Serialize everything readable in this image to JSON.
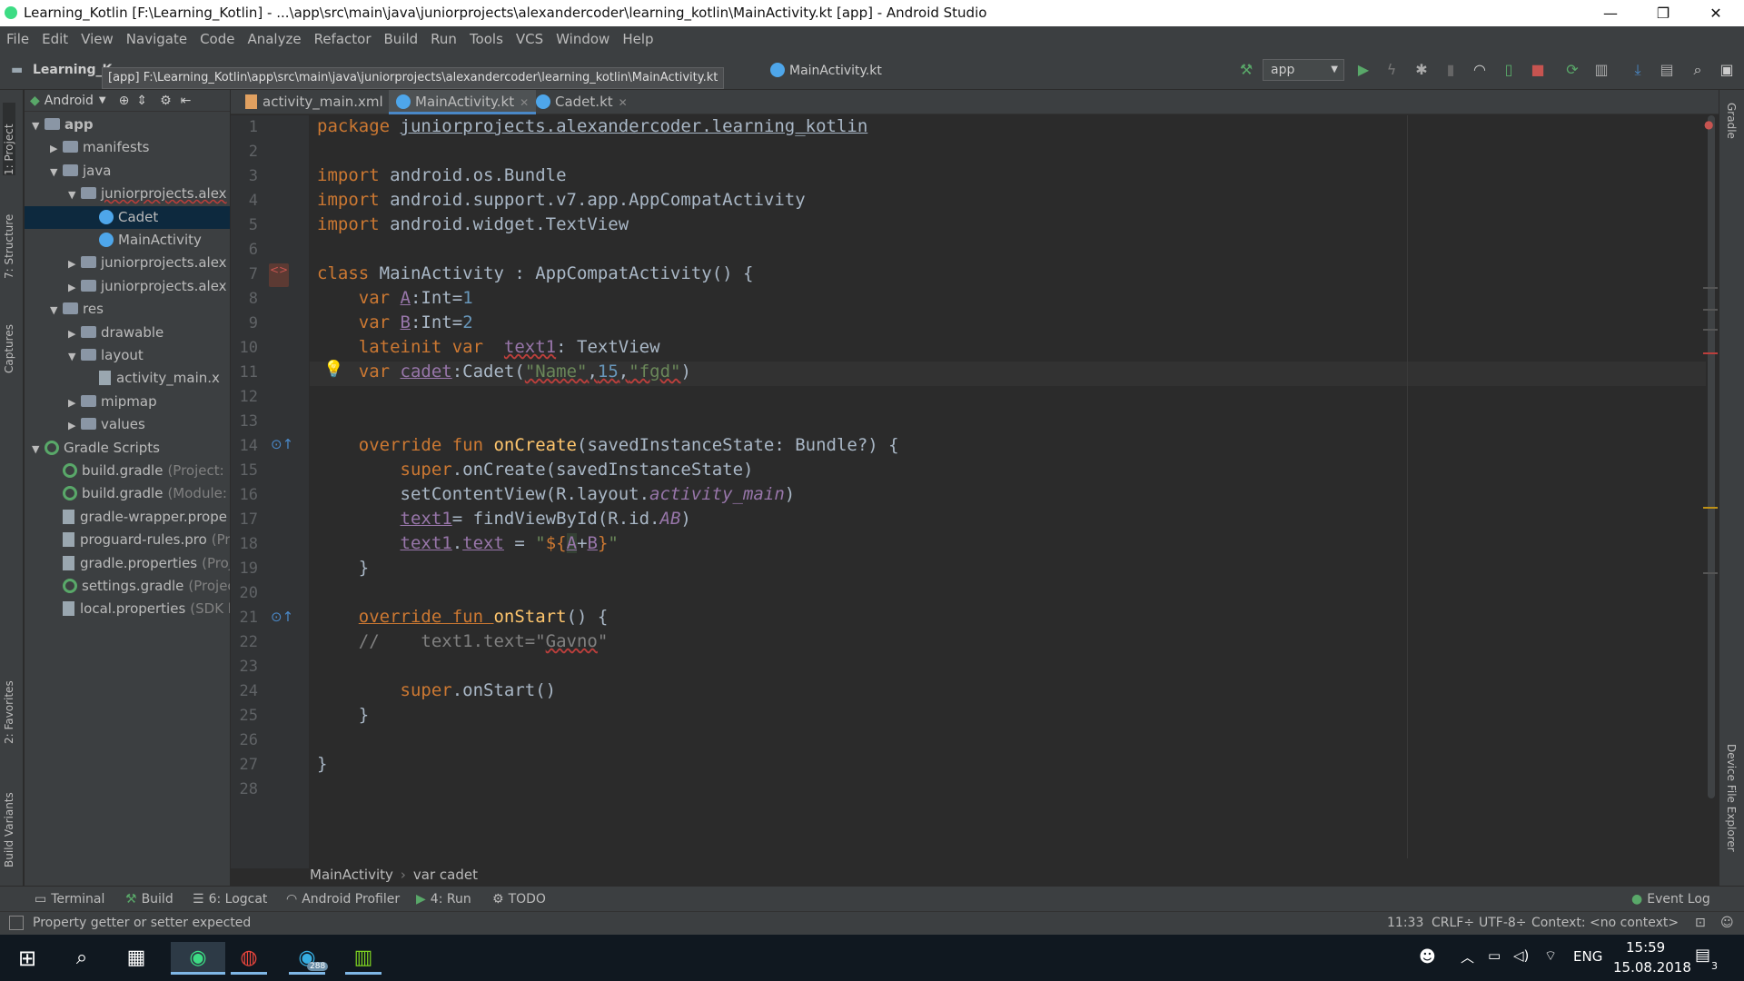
{
  "window": {
    "title": "Learning_Kotlin [F:\\Learning_Kotlin] - ...\\app\\src\\main\\java\\juniorprojects\\alexandercoder\\learning_kotlin\\MainActivity.kt [app] - Android Studio",
    "minimize": "—",
    "maximize": "❐",
    "close": "✕"
  },
  "menu": [
    "File",
    "Edit",
    "View",
    "Navigate",
    "Code",
    "Analyze",
    "Refactor",
    "Build",
    "Run",
    "Tools",
    "VCS",
    "Window",
    "Help"
  ],
  "toolbar": {
    "project_crumb": "Learning_K",
    "path_tooltip": "[app] F:\\Learning_Kotlin\\app\\src\\main\\java\\juniorprojects\\alexandercoder\\learning_kotlin\\MainActivity.kt",
    "file_crumb": "MainActivity.kt",
    "run_config": "app"
  },
  "project_panel": {
    "view_mode": "Android",
    "tree": [
      {
        "label": "app",
        "level": 0,
        "expanded": true,
        "type": "module"
      },
      {
        "label": "manifests",
        "level": 1,
        "expanded": false,
        "type": "folder"
      },
      {
        "label": "java",
        "level": 1,
        "expanded": true,
        "type": "folder"
      },
      {
        "label": "juniorprojects.alex",
        "level": 2,
        "expanded": true,
        "type": "package"
      },
      {
        "label": "Cadet",
        "level": 3,
        "type": "kotlin",
        "selected": true
      },
      {
        "label": "MainActivity",
        "level": 3,
        "type": "kotlin"
      },
      {
        "label": "juniorprojects.alex",
        "level": 2,
        "expanded": false,
        "type": "package"
      },
      {
        "label": "juniorprojects.alex",
        "level": 2,
        "expanded": false,
        "type": "package"
      },
      {
        "label": "res",
        "level": 1,
        "expanded": true,
        "type": "folder"
      },
      {
        "label": "drawable",
        "level": 2,
        "expanded": false,
        "type": "folder"
      },
      {
        "label": "layout",
        "level": 2,
        "expanded": true,
        "type": "folder"
      },
      {
        "label": "activity_main.x",
        "level": 3,
        "type": "file"
      },
      {
        "label": "mipmap",
        "level": 2,
        "expanded": false,
        "type": "folder"
      },
      {
        "label": "values",
        "level": 2,
        "expanded": false,
        "type": "folder"
      },
      {
        "label": "Gradle Scripts",
        "level": 0,
        "expanded": true,
        "type": "gradle"
      },
      {
        "label": "build.gradle",
        "hint": "(Project: L",
        "level": 1,
        "type": "gradle"
      },
      {
        "label": "build.gradle",
        "hint": "(Module:",
        "level": 1,
        "type": "gradle"
      },
      {
        "label": "gradle-wrapper.prope",
        "level": 1,
        "type": "file"
      },
      {
        "label": "proguard-rules.pro",
        "hint": "(Pr",
        "level": 1,
        "type": "file"
      },
      {
        "label": "gradle.properties",
        "hint": "(Proj",
        "level": 1,
        "type": "file"
      },
      {
        "label": "settings.gradle",
        "hint": "(Projec",
        "level": 1,
        "type": "gradle"
      },
      {
        "label": "local.properties",
        "hint": "(SDK l",
        "level": 1,
        "type": "file"
      }
    ]
  },
  "tabs": [
    {
      "label": "activity_main.xml",
      "active": false
    },
    {
      "label": "MainActivity.kt",
      "active": true
    },
    {
      "label": "Cadet.kt",
      "active": false
    }
  ],
  "side_tools_left": [
    "1: Project",
    "7: Structure",
    "Captures",
    "2: Favorites",
    "Build Variants"
  ],
  "side_tools_right": [
    "Gradle",
    "Device File Explorer"
  ],
  "editor": {
    "line_numbers": [
      "1",
      "2",
      "3",
      "4",
      "5",
      "6",
      "7",
      "8",
      "9",
      "10",
      "11",
      "12",
      "13",
      "14",
      "15",
      "16",
      "17",
      "18",
      "19",
      "20",
      "21",
      "22",
      "23",
      "24",
      "25",
      "26",
      "27",
      "28"
    ],
    "breadcrumb": [
      "MainActivity",
      "var cadet"
    ]
  },
  "bottom_tools": [
    "Terminal",
    "Build",
    "6: Logcat",
    "Android Profiler",
    "4: Run",
    "TODO",
    "Event Log"
  ],
  "status": {
    "message": "Property getter or setter expected",
    "position": "11:33",
    "line_sep": "CRLF÷",
    "encoding": "UTF-8÷",
    "context": "Context: <no context>"
  },
  "taskbar": {
    "lang": "ENG",
    "time": "15:59",
    "date": "15.08.2018",
    "notifications": "3",
    "telegram_badge": "288"
  }
}
